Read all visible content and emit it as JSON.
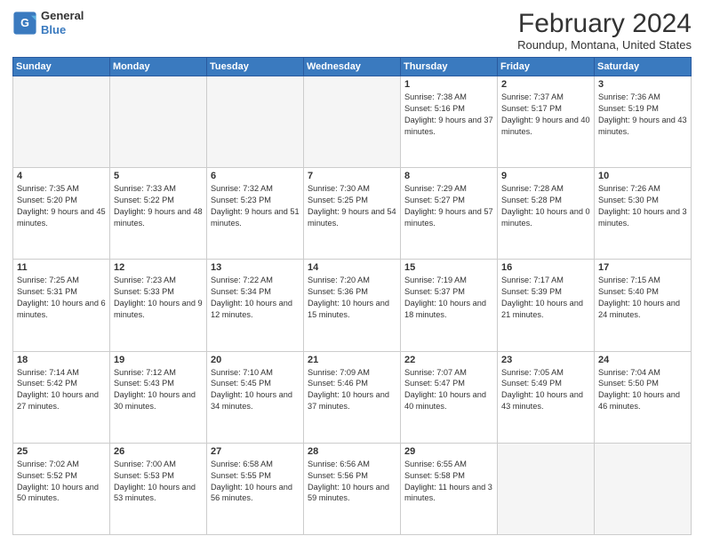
{
  "header": {
    "logo": {
      "general": "General",
      "blue": "Blue"
    },
    "title": "February 2024",
    "location": "Roundup, Montana, United States"
  },
  "days_of_week": [
    "Sunday",
    "Monday",
    "Tuesday",
    "Wednesday",
    "Thursday",
    "Friday",
    "Saturday"
  ],
  "weeks": [
    [
      {
        "day": "",
        "empty": true
      },
      {
        "day": "",
        "empty": true
      },
      {
        "day": "",
        "empty": true
      },
      {
        "day": "",
        "empty": true
      },
      {
        "day": "1",
        "sunrise": "7:38 AM",
        "sunset": "5:16 PM",
        "daylight": "9 hours and 37 minutes."
      },
      {
        "day": "2",
        "sunrise": "7:37 AM",
        "sunset": "5:17 PM",
        "daylight": "9 hours and 40 minutes."
      },
      {
        "day": "3",
        "sunrise": "7:36 AM",
        "sunset": "5:19 PM",
        "daylight": "9 hours and 43 minutes."
      }
    ],
    [
      {
        "day": "4",
        "sunrise": "7:35 AM",
        "sunset": "5:20 PM",
        "daylight": "9 hours and 45 minutes."
      },
      {
        "day": "5",
        "sunrise": "7:33 AM",
        "sunset": "5:22 PM",
        "daylight": "9 hours and 48 minutes."
      },
      {
        "day": "6",
        "sunrise": "7:32 AM",
        "sunset": "5:23 PM",
        "daylight": "9 hours and 51 minutes."
      },
      {
        "day": "7",
        "sunrise": "7:30 AM",
        "sunset": "5:25 PM",
        "daylight": "9 hours and 54 minutes."
      },
      {
        "day": "8",
        "sunrise": "7:29 AM",
        "sunset": "5:27 PM",
        "daylight": "9 hours and 57 minutes."
      },
      {
        "day": "9",
        "sunrise": "7:28 AM",
        "sunset": "5:28 PM",
        "daylight": "10 hours and 0 minutes."
      },
      {
        "day": "10",
        "sunrise": "7:26 AM",
        "sunset": "5:30 PM",
        "daylight": "10 hours and 3 minutes."
      }
    ],
    [
      {
        "day": "11",
        "sunrise": "7:25 AM",
        "sunset": "5:31 PM",
        "daylight": "10 hours and 6 minutes."
      },
      {
        "day": "12",
        "sunrise": "7:23 AM",
        "sunset": "5:33 PM",
        "daylight": "10 hours and 9 minutes."
      },
      {
        "day": "13",
        "sunrise": "7:22 AM",
        "sunset": "5:34 PM",
        "daylight": "10 hours and 12 minutes."
      },
      {
        "day": "14",
        "sunrise": "7:20 AM",
        "sunset": "5:36 PM",
        "daylight": "10 hours and 15 minutes."
      },
      {
        "day": "15",
        "sunrise": "7:19 AM",
        "sunset": "5:37 PM",
        "daylight": "10 hours and 18 minutes."
      },
      {
        "day": "16",
        "sunrise": "7:17 AM",
        "sunset": "5:39 PM",
        "daylight": "10 hours and 21 minutes."
      },
      {
        "day": "17",
        "sunrise": "7:15 AM",
        "sunset": "5:40 PM",
        "daylight": "10 hours and 24 minutes."
      }
    ],
    [
      {
        "day": "18",
        "sunrise": "7:14 AM",
        "sunset": "5:42 PM",
        "daylight": "10 hours and 27 minutes."
      },
      {
        "day": "19",
        "sunrise": "7:12 AM",
        "sunset": "5:43 PM",
        "daylight": "10 hours and 30 minutes."
      },
      {
        "day": "20",
        "sunrise": "7:10 AM",
        "sunset": "5:45 PM",
        "daylight": "10 hours and 34 minutes."
      },
      {
        "day": "21",
        "sunrise": "7:09 AM",
        "sunset": "5:46 PM",
        "daylight": "10 hours and 37 minutes."
      },
      {
        "day": "22",
        "sunrise": "7:07 AM",
        "sunset": "5:47 PM",
        "daylight": "10 hours and 40 minutes."
      },
      {
        "day": "23",
        "sunrise": "7:05 AM",
        "sunset": "5:49 PM",
        "daylight": "10 hours and 43 minutes."
      },
      {
        "day": "24",
        "sunrise": "7:04 AM",
        "sunset": "5:50 PM",
        "daylight": "10 hours and 46 minutes."
      }
    ],
    [
      {
        "day": "25",
        "sunrise": "7:02 AM",
        "sunset": "5:52 PM",
        "daylight": "10 hours and 50 minutes."
      },
      {
        "day": "26",
        "sunrise": "7:00 AM",
        "sunset": "5:53 PM",
        "daylight": "10 hours and 53 minutes."
      },
      {
        "day": "27",
        "sunrise": "6:58 AM",
        "sunset": "5:55 PM",
        "daylight": "10 hours and 56 minutes."
      },
      {
        "day": "28",
        "sunrise": "6:56 AM",
        "sunset": "5:56 PM",
        "daylight": "10 hours and 59 minutes."
      },
      {
        "day": "29",
        "sunrise": "6:55 AM",
        "sunset": "5:58 PM",
        "daylight": "11 hours and 3 minutes."
      },
      {
        "day": "",
        "empty": true
      },
      {
        "day": "",
        "empty": true
      }
    ]
  ],
  "labels": {
    "sunrise_prefix": "Sunrise: ",
    "sunset_prefix": "Sunset: ",
    "daylight_prefix": "Daylight: "
  }
}
